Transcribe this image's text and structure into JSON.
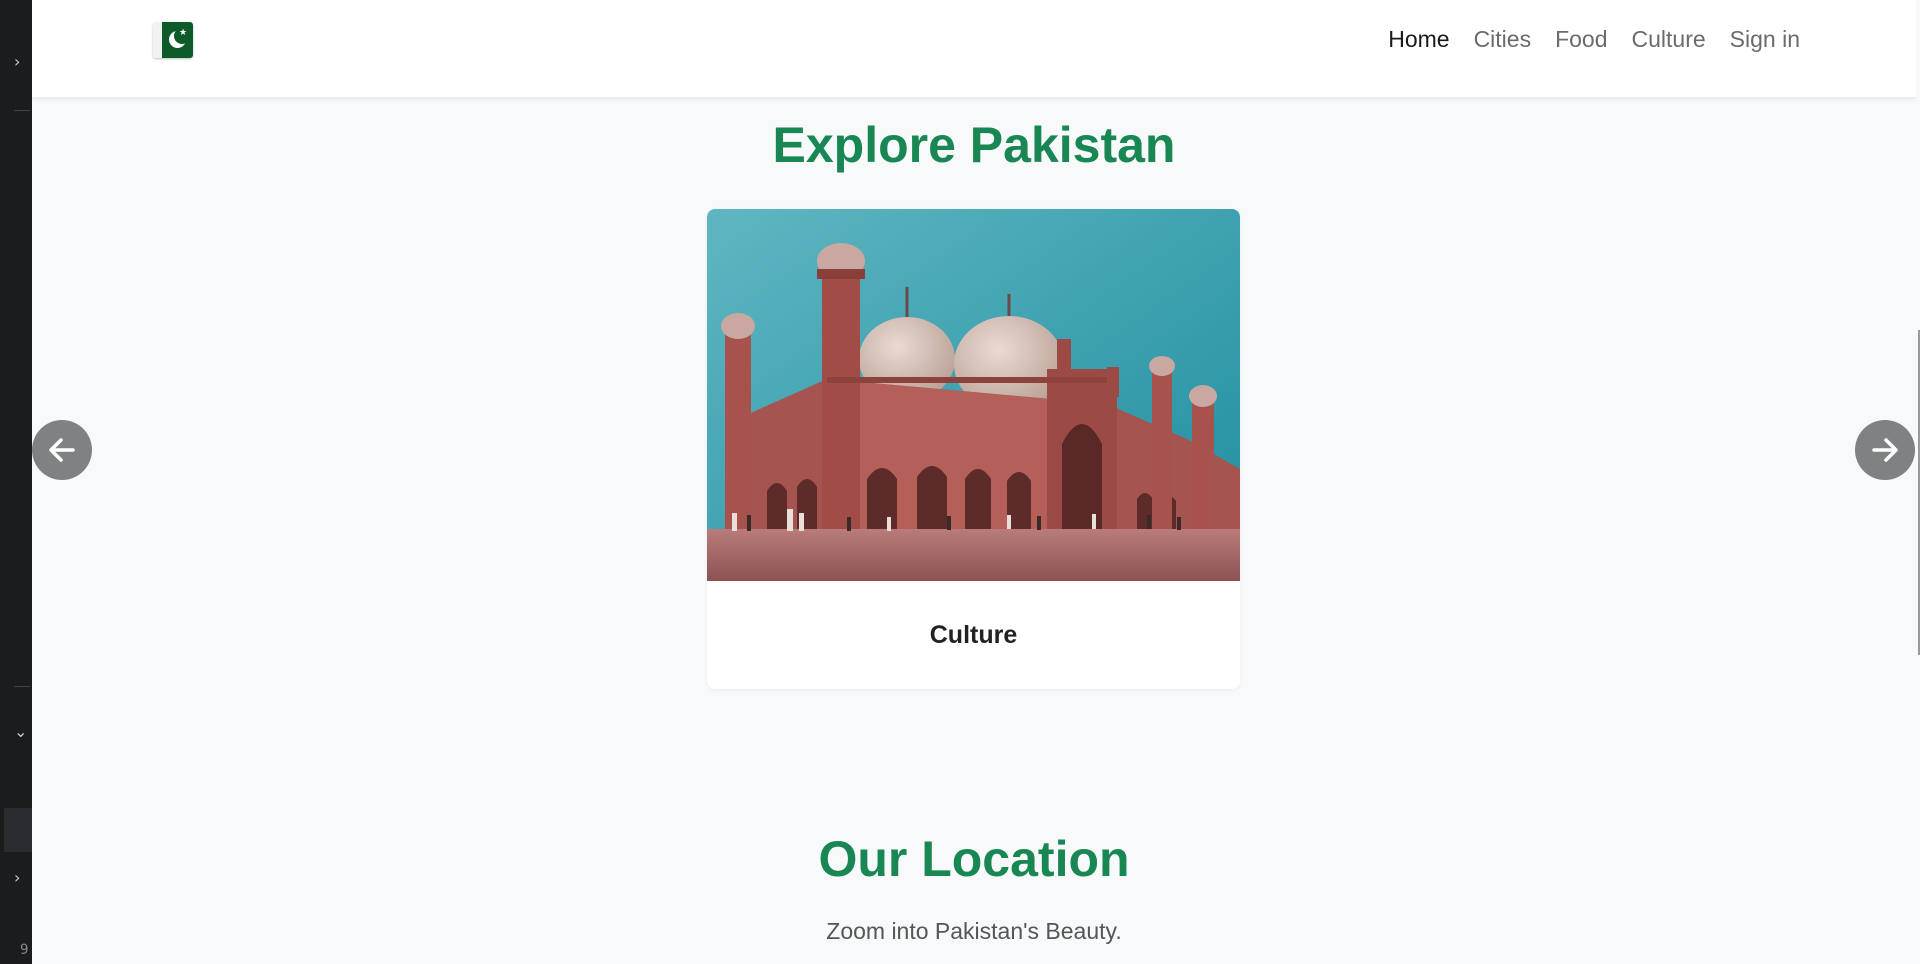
{
  "navbar": {
    "brand_icon": "pakistan-flag-icon",
    "links": [
      {
        "label": "Home",
        "active": true
      },
      {
        "label": "Cities",
        "active": false
      },
      {
        "label": "Food",
        "active": false
      },
      {
        "label": "Culture",
        "active": false
      },
      {
        "label": "Sign in",
        "active": false
      }
    ]
  },
  "explore": {
    "title": "Explore Pakistan",
    "card": {
      "title": "Culture",
      "image": "badshahi-mosque-photo"
    },
    "prev_icon": "arrow-left-icon",
    "next_icon": "arrow-right-icon"
  },
  "location": {
    "title": "Our Location",
    "subtitle": "Zoom into Pakistan's Beauty."
  },
  "gutter": {
    "line_number": "9"
  },
  "colors": {
    "accent_green": "#198754",
    "page_bg": "#f8f9fa",
    "navbar_bg": "#ffffff",
    "arrow_bg": "#7f8183"
  }
}
